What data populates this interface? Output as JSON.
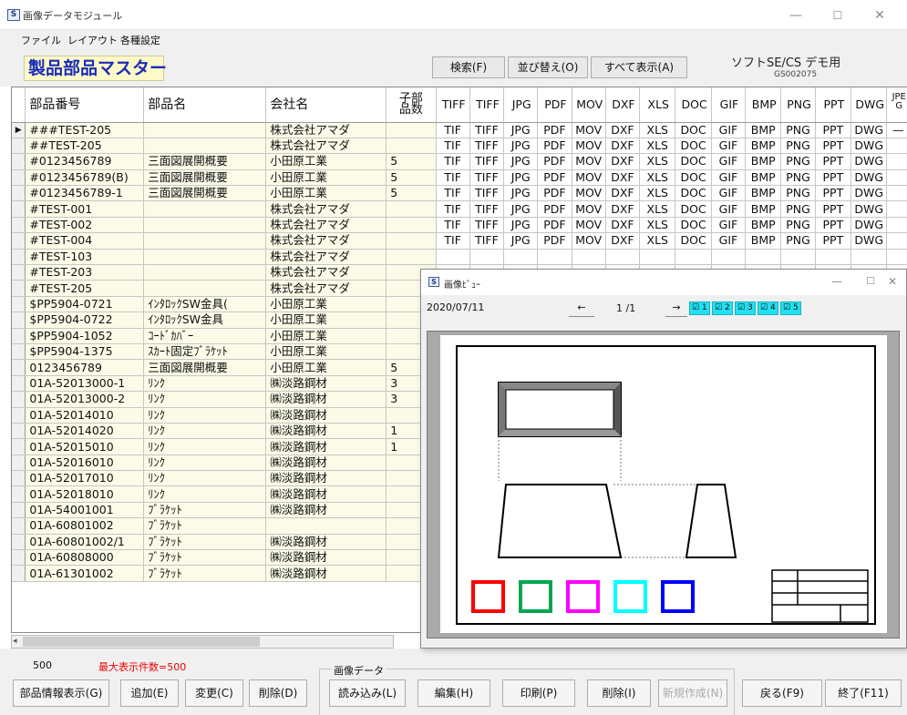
{
  "window": {
    "title": "画像データモジュール",
    "icon": "S",
    "min": "—",
    "max": "☐",
    "close": "✕"
  },
  "menu": [
    "ファイル",
    "レイアウト",
    "各種設定"
  ],
  "form_title": "製品部品マスター",
  "toolbar": {
    "search": "検索(F)",
    "sort": "並び替え(O)",
    "show_all": "すべて表示(A)",
    "demo_label": "ソフトSE/CS デモ用",
    "demo_code": "GS002075"
  },
  "grid": {
    "headers": [
      "部品番号",
      "部品名",
      "会社名",
      "子部品数"
    ],
    "file_headers": [
      "TIFF",
      "TIFF",
      "JPG",
      "PDF",
      "MOV",
      "DXF",
      "XLS",
      "DOC",
      "GIF",
      "BMP",
      "PNG",
      "PPT",
      "DWG",
      "JPEG"
    ],
    "file_values": [
      "TIF",
      "TIFF",
      "JPG",
      "PDF",
      "MOV",
      "DXF",
      "XLS",
      "DOC",
      "GIF",
      "BMP",
      "PNG",
      "PPT",
      "DWG"
    ],
    "rows": [
      {
        "no": "###TEST-205",
        "name": "",
        "company": "株式会社アマダ",
        "count": "",
        "files": true,
        "current": true
      },
      {
        "no": "##TEST-205",
        "name": "",
        "company": "株式会社アマダ",
        "count": "",
        "files": true
      },
      {
        "no": "#0123456789",
        "name": "三面図展開概要",
        "company": "小田原工業",
        "count": "5",
        "files": true
      },
      {
        "no": "#0123456789(B)",
        "name": "三面図展開概要",
        "company": "小田原工業",
        "count": "5",
        "files": true
      },
      {
        "no": "#0123456789-1",
        "name": "三面図展開概要",
        "company": "小田原工業",
        "count": "5",
        "files": true
      },
      {
        "no": "#TEST-001",
        "name": "",
        "company": "株式会社アマダ",
        "count": "",
        "files": true
      },
      {
        "no": "#TEST-002",
        "name": "",
        "company": "株式会社アマダ",
        "count": "",
        "files": true
      },
      {
        "no": "#TEST-004",
        "name": "",
        "company": "株式会社アマダ",
        "count": "",
        "files": true
      },
      {
        "no": "#TEST-103",
        "name": "",
        "company": "株式会社アマダ",
        "count": "",
        "files": false
      },
      {
        "no": "#TEST-203",
        "name": "",
        "company": "株式会社アマダ",
        "count": "",
        "files": false
      },
      {
        "no": "#TEST-205",
        "name": "",
        "company": "株式会社アマダ",
        "count": "",
        "files": false
      },
      {
        "no": "$PP5904-0721",
        "name": "ｲﾝﾀﾛｯｸSW金具(",
        "company": "小田原工業",
        "count": "",
        "files": false
      },
      {
        "no": "$PP5904-0722",
        "name": "ｲﾝﾀﾛｯｸSW金具",
        "company": "小田原工業",
        "count": "",
        "files": false
      },
      {
        "no": "$PP5904-1052",
        "name": "ｺｰﾄﾞｶﾊﾞｰ",
        "company": "小田原工業",
        "count": "",
        "files": false
      },
      {
        "no": "$PP5904-1375",
        "name": "ｽｶｰﾄ固定ﾌﾞﾗｹｯﾄ",
        "company": "小田原工業",
        "count": "",
        "files": false
      },
      {
        "no": "0123456789",
        "name": "三面図展開概要",
        "company": "小田原工業",
        "count": "5",
        "files": false
      },
      {
        "no": "01A-52013000-1",
        "name": "ﾘﾝｸ",
        "company": "㈱淡路鋼材",
        "count": "3",
        "files": false
      },
      {
        "no": "01A-52013000-2",
        "name": "ﾘﾝｸ",
        "company": "㈱淡路鋼材",
        "count": "3",
        "files": false
      },
      {
        "no": "01A-52014010",
        "name": "ﾘﾝｸ",
        "company": "㈱淡路鋼材",
        "count": "",
        "files": false
      },
      {
        "no": "01A-52014020",
        "name": "ﾘﾝｸ",
        "company": "㈱淡路鋼材",
        "count": "1",
        "files": false
      },
      {
        "no": "01A-52015010",
        "name": "ﾘﾝｸ",
        "company": "㈱淡路鋼材",
        "count": "1",
        "files": false
      },
      {
        "no": "01A-52016010",
        "name": "ﾘﾝｸ",
        "company": "㈱淡路鋼材",
        "count": "",
        "files": false
      },
      {
        "no": "01A-52017010",
        "name": "ﾘﾝｸ",
        "company": "㈱淡路鋼材",
        "count": "",
        "files": false
      },
      {
        "no": "01A-52018010",
        "name": "ﾘﾝｸ",
        "company": "㈱淡路鋼材",
        "count": "",
        "files": false
      },
      {
        "no": "01A-54001001",
        "name": "ﾌﾞﾗｹｯﾄ",
        "company": "㈱淡路鋼材",
        "count": "",
        "files": false
      },
      {
        "no": "01A-60801002",
        "name": "ﾌﾞﾗｹｯﾄ",
        "company": "",
        "count": "",
        "files": false
      },
      {
        "no": "01A-60801002/1",
        "name": "ﾌﾞﾗｹｯﾄ",
        "company": "㈱淡路鋼材",
        "count": "",
        "files": false
      },
      {
        "no": "01A-60808000",
        "name": "ﾌﾞﾗｹｯﾄ",
        "company": "㈱淡路鋼材",
        "count": "",
        "files": false
      },
      {
        "no": "01A-61301002",
        "name": "ﾌﾞﾗｹｯﾄ",
        "company": "㈱淡路鋼材",
        "count": "",
        "files": false
      }
    ]
  },
  "status": {
    "count": "500",
    "max_label": "最大表示件数=500"
  },
  "bottom": {
    "part_info": "部品情報表示(G)",
    "add": "追加(E)",
    "change": "変更(C)",
    "delete": "削除(D)",
    "group_label": "画像データ",
    "load": "読み込み(L)",
    "edit": "編集(H)",
    "print": "印刷(P)",
    "img_delete": "削除(I)",
    "new": "新規作成(N)",
    "back": "戻る(F9)",
    "exit": "終了(F11)"
  },
  "viewer": {
    "title": "画像ﾋﾞｭｰ",
    "date": "2020/07/11",
    "prev": "←",
    "next": "→",
    "page": "1 /1",
    "pages": [
      "1",
      "2",
      "3",
      "4",
      "5"
    ],
    "swatch_colors": [
      "#ff0000",
      "#00a651",
      "#ff00ff",
      "#00ffff",
      "#0000ff"
    ]
  }
}
